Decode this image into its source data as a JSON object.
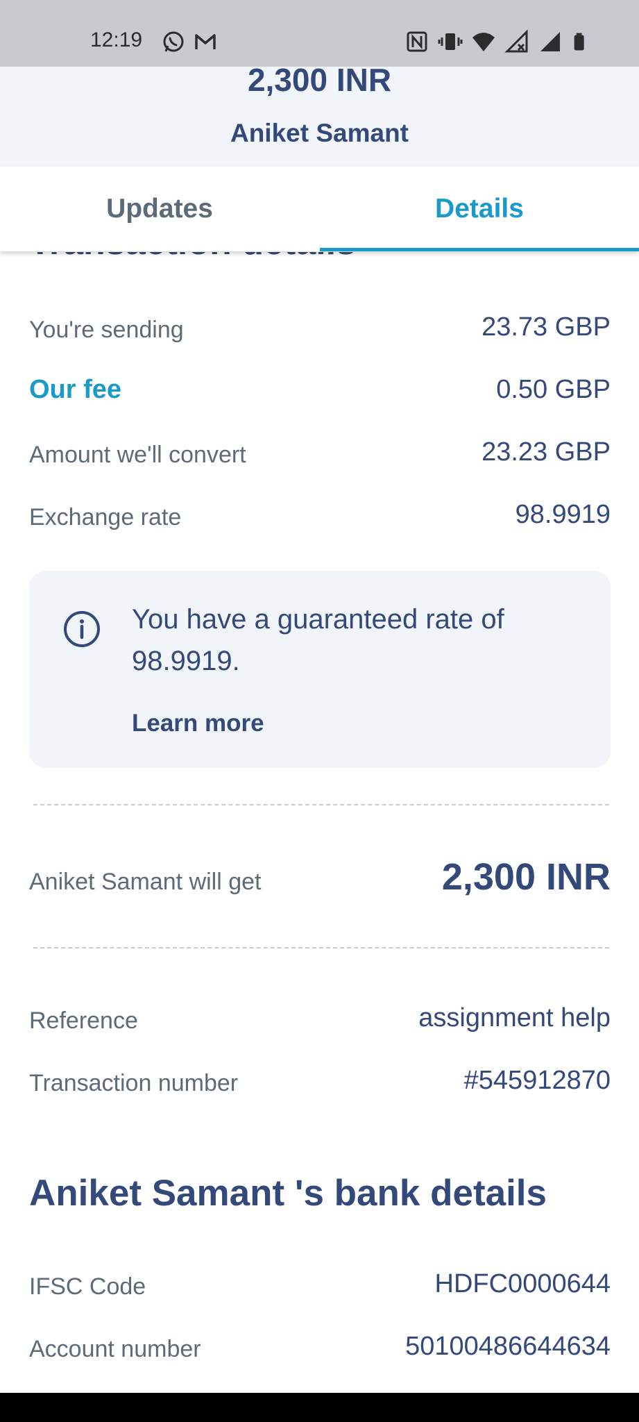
{
  "status_bar": {
    "time": "12:19",
    "left_icons": [
      "whatsapp-icon",
      "gmail-icon"
    ],
    "right_icons": [
      "nfc-icon",
      "vibrate-icon",
      "wifi-icon",
      "signal-no-data-icon",
      "signal-icon",
      "battery-icon"
    ]
  },
  "header": {
    "amount": "2,300 INR",
    "recipient": "Aniket Samant",
    "close_icon": "close-icon",
    "help_icon": "help-icon"
  },
  "tabs": [
    {
      "label": "Updates",
      "active": false
    },
    {
      "label": "Details",
      "active": true
    }
  ],
  "transaction": {
    "heading": "Transaction details",
    "rows": [
      {
        "label": "You're sending",
        "value": "23.73 GBP"
      },
      {
        "label": "Our fee",
        "value": "0.50 GBP"
      },
      {
        "label": "Amount we'll convert",
        "value": "23.23 GBP"
      },
      {
        "label": "Exchange rate",
        "value": "98.9919"
      }
    ]
  },
  "info": {
    "text": "You have a guaranteed rate of 98.9919.",
    "link": "Learn more"
  },
  "receive": {
    "label": "Aniket Samant  will get",
    "amount": "2,300 INR"
  },
  "reference_rows": [
    {
      "label": "Reference",
      "value": "assignment help"
    },
    {
      "label": "Transaction number",
      "value": "#545912870"
    }
  ],
  "bank": {
    "heading": "Aniket Samant 's bank details",
    "rows": [
      {
        "label": "IFSC Code",
        "value": "HDFC0000644"
      },
      {
        "label": "Account number",
        "value": "50100486644634"
      }
    ]
  },
  "colors": {
    "accent": "#1a9ac9",
    "navy": "#34497a",
    "muted": "#5d6a78",
    "panel": "#f1f4f8"
  }
}
